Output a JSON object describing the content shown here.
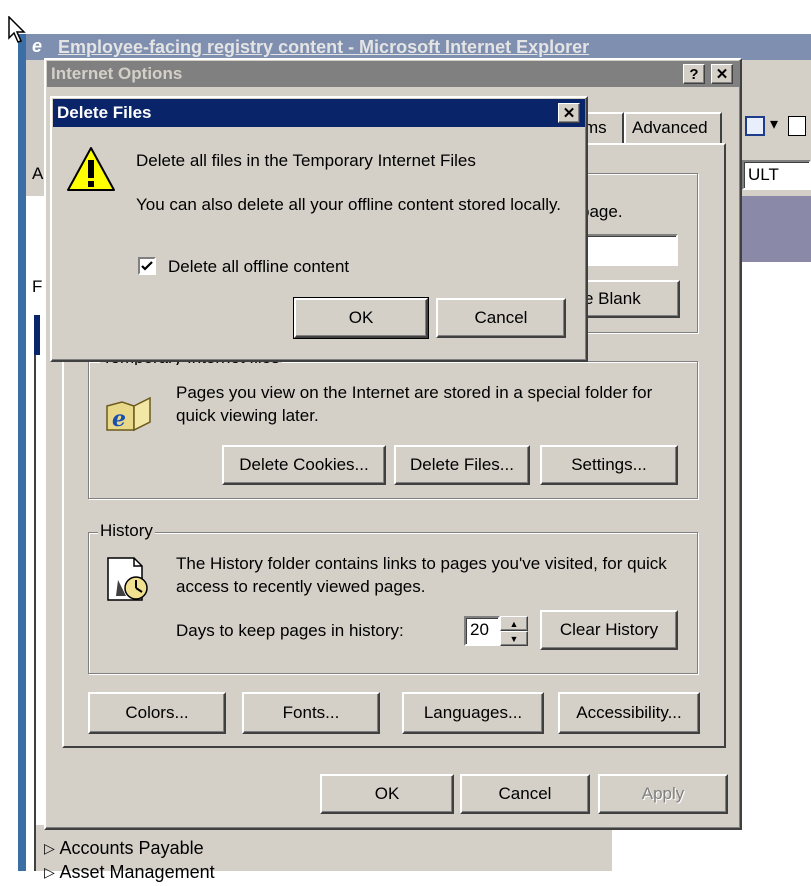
{
  "ie_window": {
    "title": "Employee-facing registry content - Microsoft Internet Explorer",
    "address_stub": "A",
    "address_suffix": "ULT",
    "left_menu_letters": [
      "F",
      "F"
    ],
    "tree_items": [
      "Accounts Payable",
      "Asset Management"
    ]
  },
  "internet_options": {
    "title": "Internet Options",
    "help_label": "?",
    "close_label": "✕",
    "tabs": {
      "programs_partial": "ms",
      "advanced": "Advanced"
    },
    "home_page": {
      "text_partial": "page.",
      "use_blank": "e Blank"
    },
    "temp_files": {
      "legend": "Temporary Internet files",
      "description": "Pages you view on the Internet are stored in a special folder for quick viewing later.",
      "delete_cookies": "Delete Cookies...",
      "delete_files": "Delete Files...",
      "settings": "Settings..."
    },
    "history": {
      "legend": "History",
      "description": "The History folder contains links to pages you've visited, for quick access to recently viewed pages.",
      "days_label": "Days to keep pages in history:",
      "days_value": "20",
      "clear_history": "Clear History"
    },
    "bottom_buttons": {
      "colors": "Colors...",
      "fonts": "Fonts...",
      "languages": "Languages...",
      "accessibility": "Accessibility..."
    },
    "footer": {
      "ok": "OK",
      "cancel": "Cancel",
      "apply": "Apply"
    }
  },
  "delete_files": {
    "title": "Delete Files",
    "close_label": "✕",
    "line1": "Delete all files in the Temporary Internet Files",
    "line2": "You can also delete all your offline content stored locally.",
    "checkbox_label": "Delete all offline content",
    "checkbox_checked": true,
    "ok": "OK",
    "cancel": "Cancel"
  },
  "colors": {
    "titlebar_active": "#0a246a",
    "titlebar_inactive": "#808080",
    "dialog_face": "#d4d0c8"
  }
}
